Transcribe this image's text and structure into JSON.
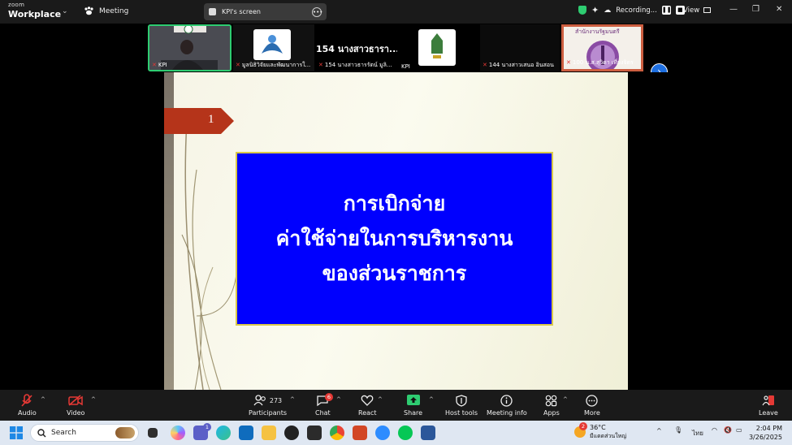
{
  "titlebar": {
    "brand_small": "zoom",
    "brand_big": "Workplace",
    "meeting_label": "Meeting",
    "screen_label": "KPI's screen",
    "recording_label": "Recording...",
    "view_label": "View"
  },
  "participants": [
    {
      "name": "KPI"
    },
    {
      "name": "มูลนิธิวิจัยและพัฒนาการใ..."
    },
    {
      "name": "154 นางสาวธารรัตน์ มูลิ...",
      "display": "154 นางสาวธารา..."
    },
    {
      "name": "KPI"
    },
    {
      "name": "144 นางสาวเสนอ อินสอน"
    },
    {
      "name": "100 น.ส.สุวิดา เที่ยงจิตร",
      "display": "สำนักงานรัฐมนตรี"
    }
  ],
  "slide": {
    "number": "1",
    "lines": [
      "การเบิกจ่าย",
      "ค่าใช้จ่ายในการบริหารงาน",
      "ของส่วนราชการ"
    ]
  },
  "toolbar": {
    "audio": "Audio",
    "video": "Video",
    "participants": "Participants",
    "participants_count": "273",
    "chat": "Chat",
    "chat_badge": "6",
    "react": "React",
    "share": "Share",
    "host_tools": "Host tools",
    "meeting_info": "Meeting info",
    "apps": "Apps",
    "more": "More",
    "leave": "Leave"
  },
  "taskbar": {
    "search_placeholder": "Search",
    "teams_badge": "1",
    "weather_badge": "2",
    "temperature": "36°C",
    "weather_desc": "มีแดดส่วนใหญ่",
    "language": "ไทย",
    "time": "2:04 PM",
    "date": "3/26/2025"
  },
  "colors": {
    "accent_green": "#2ecc71",
    "slide_blue": "#0000fe",
    "tag_red": "#b5341a",
    "mute_red": "#e53935"
  }
}
